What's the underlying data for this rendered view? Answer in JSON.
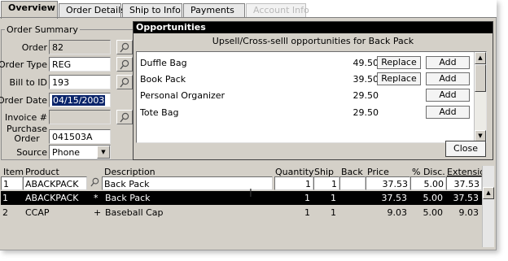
{
  "tabs": [
    {
      "label": "Overview",
      "state": "active"
    },
    {
      "label": "Order Details",
      "state": "normal"
    },
    {
      "label": "Ship to Info",
      "state": "normal"
    },
    {
      "label": "Payments",
      "state": "normal"
    },
    {
      "label": "Account Info",
      "state": "disabled"
    }
  ],
  "order_summary": {
    "legend": "Order Summary",
    "order_label": "Order",
    "order_value": "82",
    "order_type_label": "Order Type",
    "order_type_value": "REG",
    "bill_to_label": "Bill to ID",
    "bill_to_value": "193",
    "order_date_label": "Order Date",
    "order_date_value": "04/15/2003",
    "invoice_label": "Invoice #",
    "invoice_value": "",
    "purchase_order_label_1": "Purchase",
    "purchase_order_label_2": "Order",
    "purchase_order_value": "041503A",
    "source_label": "Source",
    "source_value": "Phone"
  },
  "opportunities": {
    "title": "Opportunities",
    "heading": "Upsell/Cross-selll opportunities for Back Pack",
    "items": [
      {
        "name": "Duffle Bag",
        "price": "49.50",
        "replace": "Replace",
        "add": "Add"
      },
      {
        "name": "Book Pack",
        "price": "39.50",
        "replace": "Replace",
        "add": "Add"
      },
      {
        "name": "Personal Organizer",
        "price": "29.50",
        "replace": "",
        "add": "Add"
      },
      {
        "name": "Tote Bag",
        "price": "29.50",
        "replace": "",
        "add": "Add"
      }
    ],
    "close_label": "Close"
  },
  "grid": {
    "headers": {
      "item": "Item",
      "product": "Product",
      "description": "Description",
      "quantity": "Quantity",
      "ship": "Ship",
      "back": "Back",
      "price": "Price",
      "disc": "% Disc.",
      "extension": "Extension"
    },
    "rows": [
      {
        "item": "1",
        "product": "ABACKPACK",
        "marker": "",
        "description": "Back Pack",
        "quantity": "1",
        "ship": "1",
        "back": "",
        "price": "37.53",
        "disc": "5.00",
        "extension": "37.53"
      },
      {
        "item": "1",
        "product": "ABACKPACK",
        "marker": "*",
        "description": "Back Pack",
        "quantity": "1",
        "ship": "1",
        "back": "",
        "price": "37.53",
        "disc": "5.00",
        "extension": "37.53"
      },
      {
        "item": "2",
        "product": "CCAP",
        "marker": "+",
        "description": "Baseball Cap",
        "quantity": "1",
        "ship": "1",
        "back": "",
        "price": "9.03",
        "disc": "5.00",
        "extension": "9.03"
      }
    ]
  },
  "colors": {
    "window_bg": "#d4d0c8",
    "title_bar": "#000000",
    "selection": "#0a246a"
  }
}
